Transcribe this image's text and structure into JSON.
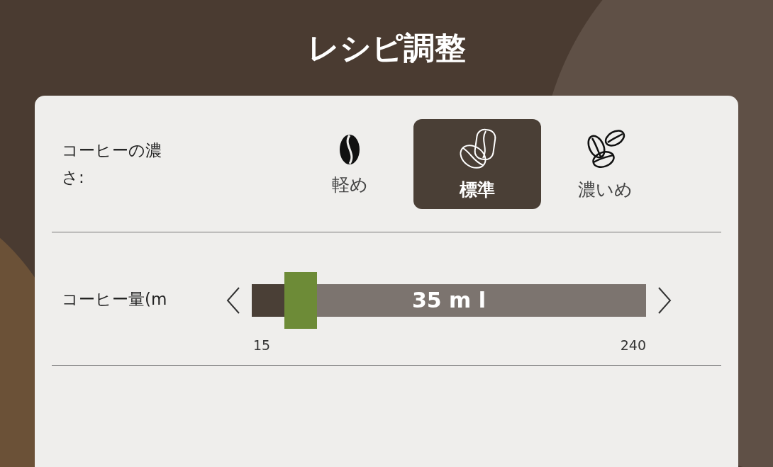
{
  "title": "レシピ調整",
  "strength": {
    "label": "コーヒーの濃さ:",
    "options": [
      {
        "kind": "light",
        "label": "軽め",
        "selected": false
      },
      {
        "kind": "medium",
        "label": "標準",
        "selected": true
      },
      {
        "kind": "strong",
        "label": "濃いめ",
        "selected": false
      }
    ]
  },
  "amount": {
    "label": "コーヒー量(m",
    "value": "35 m l",
    "level": 0.09,
    "min": "15",
    "max": "240"
  }
}
